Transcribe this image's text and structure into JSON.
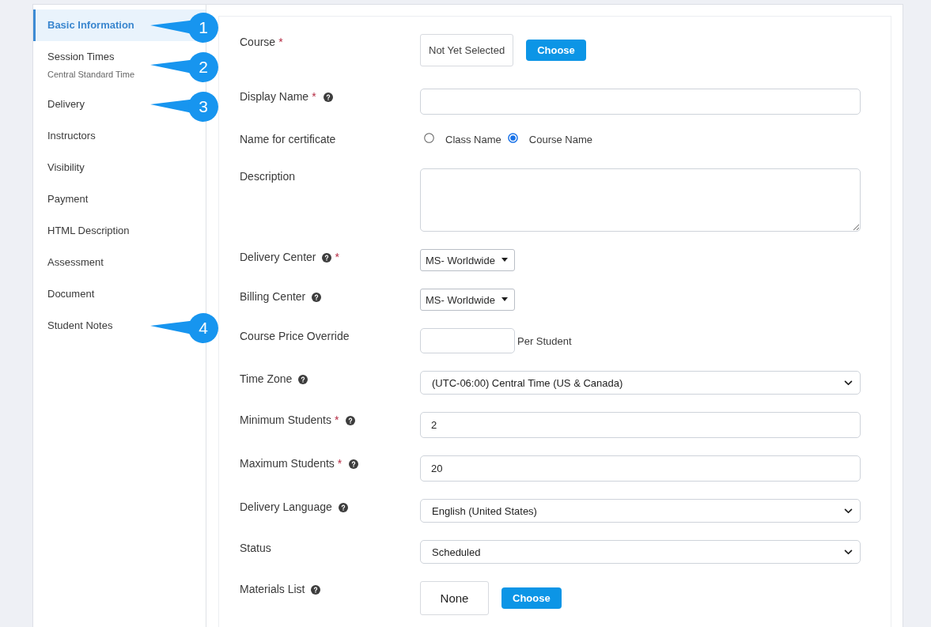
{
  "sidebar": {
    "items": [
      {
        "label": "Basic Information",
        "selected": true,
        "callout": "1"
      },
      {
        "label": "Session Times",
        "caption": "Central Standard Time",
        "selected": false,
        "callout": "2"
      },
      {
        "label": "Delivery",
        "selected": false,
        "callout": "3"
      },
      {
        "label": "Instructors",
        "selected": false
      },
      {
        "label": "Visibility",
        "selected": false
      },
      {
        "label": "Payment",
        "selected": false
      },
      {
        "label": "HTML Description",
        "selected": false
      },
      {
        "label": "Assessment",
        "selected": false
      },
      {
        "label": "Document",
        "selected": false
      },
      {
        "label": "Student Notes",
        "selected": false,
        "callout": "4"
      }
    ]
  },
  "form": {
    "fields": [
      {
        "kind": "picker",
        "label": "Course",
        "marks": [
          {
            "kind": "required",
            "text": "*"
          }
        ],
        "value": "Not Yet Selected",
        "button": "Choose"
      },
      {
        "kind": "text",
        "label": "Display Name",
        "marks": [
          {
            "kind": "required",
            "text": "*"
          },
          {
            "kind": "help"
          }
        ]
      },
      {
        "kind": "radio",
        "label": "Name for certificate",
        "options": [
          {
            "label": "Class Name",
            "selected": false
          },
          {
            "label": "Course Name",
            "selected": true
          }
        ]
      },
      {
        "kind": "textarea",
        "label": "Description"
      },
      {
        "kind": "dropdown",
        "label": "Delivery Center",
        "marks": [
          {
            "kind": "help"
          },
          {
            "kind": "required",
            "text": "*"
          }
        ],
        "value": "MS- Worldwide"
      },
      {
        "kind": "dropdown",
        "label": "Billing Center",
        "marks": [
          {
            "kind": "help"
          }
        ],
        "value": "MS- Worldwide"
      },
      {
        "kind": "amount",
        "label": "Course Price Override",
        "suffix": "Per Student"
      },
      {
        "kind": "select",
        "label": "Time Zone",
        "marks": [
          {
            "kind": "help"
          }
        ],
        "value": "(UTC-06:00) Central Time (US & Canada)"
      },
      {
        "kind": "text",
        "label": "Minimum Students",
        "marks": [
          {
            "kind": "required",
            "text": "*"
          },
          {
            "kind": "help"
          }
        ],
        "value": "2"
      },
      {
        "kind": "text",
        "label": "Maximum Students",
        "marks": [
          {
            "kind": "required",
            "text": "*"
          },
          {
            "kind": "help"
          }
        ],
        "value": "20"
      },
      {
        "kind": "select",
        "label": "Delivery Language",
        "marks": [
          {
            "kind": "help"
          }
        ],
        "value": "English (United States)"
      },
      {
        "kind": "select",
        "label": "Status",
        "value": "Scheduled"
      },
      {
        "kind": "picklist",
        "label": "Materials List",
        "marks": [
          {
            "kind": "help"
          }
        ],
        "value": "None",
        "button": "Choose"
      }
    ]
  }
}
